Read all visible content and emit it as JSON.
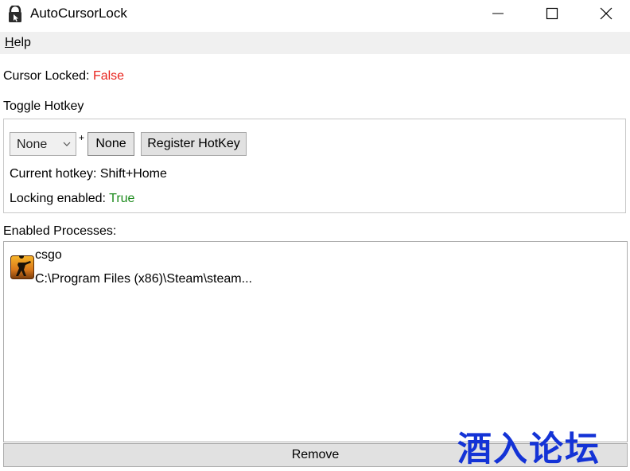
{
  "window": {
    "title": "AutoCursorLock",
    "minimize_icon": "minimize-icon",
    "maximize_icon": "maximize-icon",
    "close_icon": "close-icon"
  },
  "menu": {
    "help_underline": "H",
    "help_rest": "elp"
  },
  "status": {
    "cursor_label": "Cursor Locked:",
    "cursor_value": "False"
  },
  "hotkey_group": {
    "label": "Toggle Hotkey",
    "modifier_selected": "None",
    "plus": "+",
    "key_button": "None",
    "register_button": "Register HotKey",
    "current_label": "Current hotkey:",
    "current_value": "Shift+Home",
    "locking_label": "Locking enabled:",
    "locking_value": "True"
  },
  "processes": {
    "label": "Enabled Processes:",
    "items": [
      {
        "name": "csgo",
        "path": "C:\\Program Files (x86)\\Steam\\steam...",
        "icon": "csgo-icon"
      }
    ]
  },
  "remove_button": "Remove",
  "watermark": "酒入论坛",
  "colors": {
    "false": "#e8231d",
    "true": "#1c8a1c",
    "watermark": "#1433d6"
  }
}
